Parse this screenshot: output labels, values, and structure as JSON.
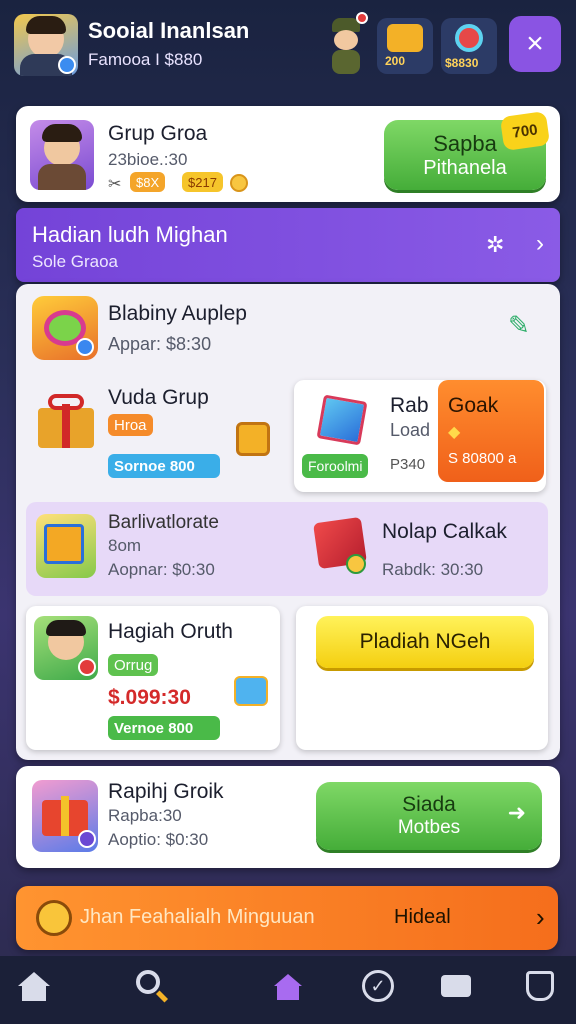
{
  "header": {
    "title": "Sooial Inanlsan",
    "subtitle": "Famooa I $880",
    "thumb1_label": "200",
    "thumb2_label": "$8830",
    "close_label": "×"
  },
  "profile_card": {
    "name": "Grup Groa",
    "stats": "23bioe.:30",
    "badge1": "$8X",
    "badge2": "$217",
    "button_line1": "Sapba",
    "button_line2": "Pithanela",
    "button_badge": "700"
  },
  "banner": {
    "title": "Hadian ludh Mighan",
    "subtitle": "Sole Graoa"
  },
  "items": {
    "item1": {
      "title": "Blabiny Auplep",
      "sub": "Appar: $8:30"
    },
    "item2": {
      "title": "Vuda Grup",
      "tag": "Hroa",
      "pill": "Sornoe 800"
    },
    "item3": {
      "title": "Rab",
      "sub": "Load",
      "tag": "Foroolmi",
      "price": "P340"
    },
    "item4": {
      "title": "Goak",
      "sub": "S 80800 a"
    },
    "item5": {
      "title": "Barlivatlorate",
      "line2": "8om",
      "line3": "Aopnar: $0:30"
    },
    "item6": {
      "title": "Nolap Calkak",
      "sub": "Rabdk: 30:30"
    },
    "item7": {
      "title": "Hagiah Oruth",
      "tag": "Orrug",
      "price": "$.099:30",
      "pill": "Vernoe 800"
    },
    "item8": {
      "button": "Pladiah NGeh"
    },
    "item9": {
      "title": "Rapihj Groik",
      "line2": "Rapba:30",
      "line3": "Aoptio: $0:30",
      "button_line1": "Siada",
      "button_line2": "Motbes"
    }
  },
  "footer_bar": {
    "label": "Jhan Feahalialh Minguuan",
    "action": "Hideal"
  },
  "colors": {
    "accent_purple": "#6f3fd1",
    "green": "#45ad39",
    "orange": "#f0601a",
    "yellow": "#f4cf10"
  }
}
